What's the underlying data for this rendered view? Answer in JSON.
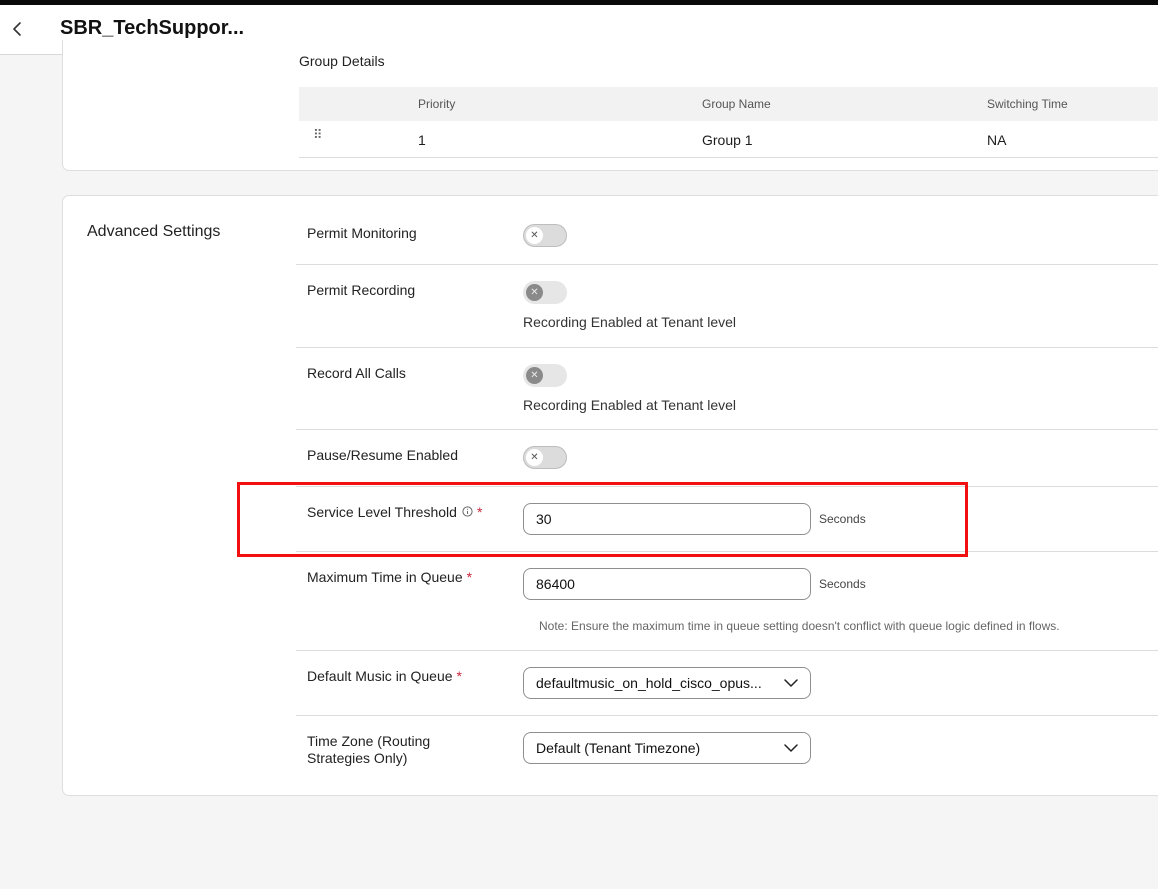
{
  "header": {
    "title": "SBR_TechSuppor..."
  },
  "group_details": {
    "label": "Group Details",
    "columns": [
      "Priority",
      "Group Name",
      "Switching Time"
    ],
    "rows": [
      {
        "priority": "1",
        "group_name": "Group 1",
        "switching_time": "NA"
      }
    ]
  },
  "advanced": {
    "title": "Advanced Settings",
    "permit_monitoring": {
      "label": "Permit Monitoring",
      "enabled": false
    },
    "permit_recording": {
      "label": "Permit Recording",
      "enabled": false,
      "helper": "Recording Enabled at Tenant level"
    },
    "record_all_calls": {
      "label": "Record All Calls",
      "enabled": false,
      "helper": "Recording Enabled at Tenant level"
    },
    "pause_resume": {
      "label": "Pause/Resume Enabled",
      "enabled": false
    },
    "service_level_threshold": {
      "label": "Service Level Threshold",
      "value": "30",
      "unit": "Seconds",
      "required": "*"
    },
    "max_time_in_queue": {
      "label": "Maximum Time in Queue",
      "value": "86400",
      "unit": "Seconds",
      "required": "*",
      "note": "Note: Ensure the maximum time in queue setting doesn't conflict with queue logic defined in flows."
    },
    "default_music": {
      "label": "Default Music in Queue",
      "value": "defaultmusic_on_hold_cisco_opus...",
      "required": "*"
    },
    "time_zone": {
      "label_line1": "Time Zone (Routing",
      "label_line2": "Strategies Only)",
      "value": "Default (Tenant Timezone)"
    }
  },
  "icons": {
    "back": "chevron-left-icon",
    "drag": "drag-handle-icon",
    "info": "info-icon",
    "dropdown": "chevron-down-icon"
  },
  "colors": {
    "required": "#c7253a",
    "highlight": "#f20f0f"
  }
}
